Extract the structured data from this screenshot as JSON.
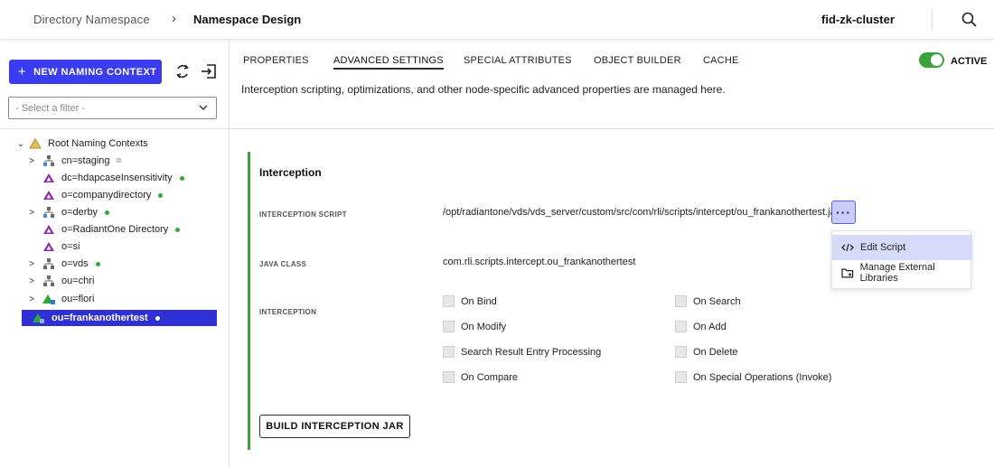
{
  "header": {
    "breadcrumb_root": "Directory Namespace",
    "breadcrumb_separator": "›",
    "breadcrumb_current": "Namespace Design",
    "cluster": "fid-zk-cluster",
    "search_icon": "search-icon"
  },
  "sidebar": {
    "new_context_plus": "+",
    "new_context_label": "NEW NAMING CONTEXT",
    "filter_placeholder": "- Select a filter -",
    "tree": {
      "root": {
        "label": "Root Naming Contexts",
        "toggle": "⌄"
      },
      "items": [
        {
          "label": "cn=staging",
          "toggle": ">",
          "icon": "hierarchy-icon",
          "link_mark": "⧉"
        },
        {
          "label": "dc=hdapcaseInsensitivity",
          "toggle": "",
          "icon": "triangle-icon"
        },
        {
          "label": "o=companydirectory",
          "toggle": "",
          "icon": "triangle-icon"
        },
        {
          "label": "o=derby",
          "toggle": ">",
          "icon": "hierarchy-icon"
        },
        {
          "label": "o=RadiantOne Directory",
          "toggle": "",
          "icon": "triangle-icon"
        },
        {
          "label": "o=si",
          "toggle": "",
          "icon": "triangle-icon"
        },
        {
          "label": "o=vds",
          "toggle": ">",
          "icon": "hierarchy-icon"
        },
        {
          "label": "ou=chri",
          "toggle": ">",
          "icon": "hierarchy-icon"
        },
        {
          "label": "ou=flori",
          "toggle": ">",
          "icon": "triangle-icon"
        },
        {
          "label": "ou=frankanothertest",
          "toggle": "",
          "icon": "triangle-icon"
        }
      ]
    }
  },
  "tabs": [
    {
      "label": "PROPERTIES",
      "active": false
    },
    {
      "label": "ADVANCED SETTINGS",
      "active": true
    },
    {
      "label": "SPECIAL ATTRIBUTES",
      "active": false
    },
    {
      "label": "OBJECT BUILDER",
      "active": false
    },
    {
      "label": "CACHE",
      "active": false
    }
  ],
  "status": {
    "toggle_on": true,
    "label": "ACTIVE"
  },
  "description": "Interception scripting, optimizations, and other node-specific advanced properties are managed here.",
  "interception": {
    "title": "Interception",
    "script_label": "INTERCEPTION SCRIPT",
    "script_path": "/opt/radiantone/vds/vds_server/custom/src/com/rli/scripts/intercept/ou_frankanothertest.java",
    "more_button": "···",
    "java_class_label": "JAVA CLASS",
    "java_class": "com.rli.scripts.intercept.ou_frankanothertest",
    "interception_label": "INTERCEPTION",
    "options_left": [
      "On Bind",
      "On Modify",
      "Search Result Entry Processing",
      "On Compare"
    ],
    "options_right": [
      "On Search",
      "On Add",
      "On Delete",
      "On Special Operations (Invoke)"
    ],
    "build_button": "BUILD INTERCEPTION JAR"
  },
  "context_menu": {
    "items": [
      {
        "label": "Edit Script",
        "icon": "code-icon"
      },
      {
        "label": "Manage External Libraries",
        "icon": "folder-icon"
      }
    ]
  },
  "colors": {
    "accent": "#3b3bf0",
    "selected": "#2f2fd6",
    "active_green": "#3ca33c",
    "status_dot": "#2eaa3a"
  }
}
